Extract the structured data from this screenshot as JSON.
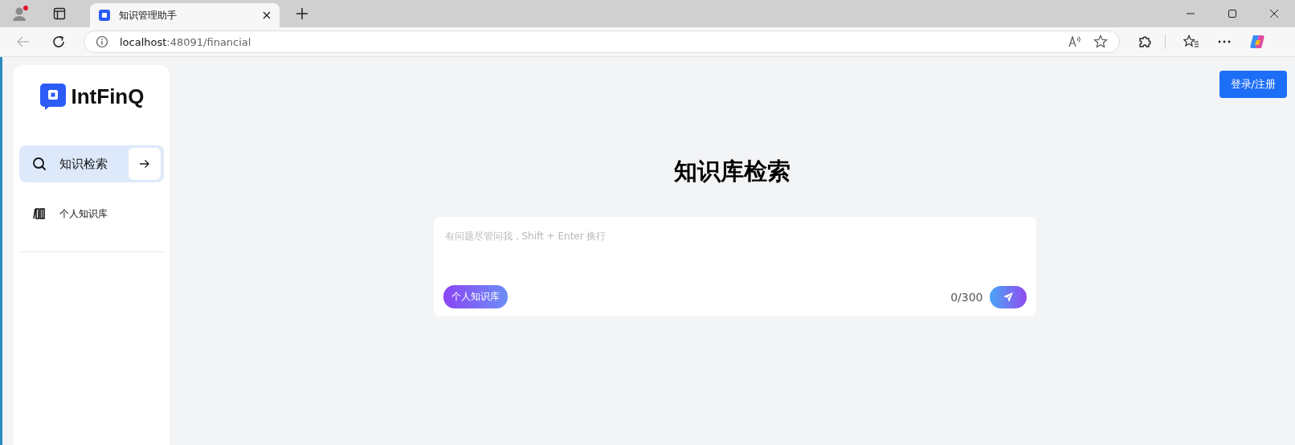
{
  "browser": {
    "tab": {
      "title": "知识管理助手",
      "selected": true
    },
    "address": {
      "host": "localhost",
      "path": ":48091/financial"
    }
  },
  "header": {
    "login_button": "登录/注册"
  },
  "sidebar": {
    "logo": "IntFinQ",
    "items": [
      {
        "label": "知识检索",
        "selected": true
      },
      {
        "label": "个人知识库",
        "selected": false
      }
    ]
  },
  "main": {
    "title": "知识库检索",
    "input": {
      "placeholder": "有问题尽管问我，Shift + Enter 换行"
    },
    "scope_tag": "个人知识库",
    "counter": "0/300"
  }
}
